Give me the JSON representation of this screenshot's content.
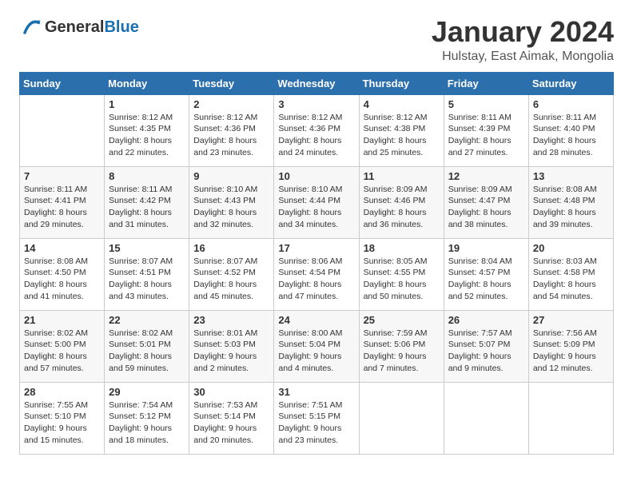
{
  "header": {
    "logo_general": "General",
    "logo_blue": "Blue",
    "month": "January 2024",
    "location": "Hulstay, East Aimak, Mongolia"
  },
  "days_of_week": [
    "Sunday",
    "Monday",
    "Tuesday",
    "Wednesday",
    "Thursday",
    "Friday",
    "Saturday"
  ],
  "weeks": [
    [
      {
        "day": "",
        "info": ""
      },
      {
        "day": "1",
        "info": "Sunrise: 8:12 AM\nSunset: 4:35 PM\nDaylight: 8 hours\nand 22 minutes."
      },
      {
        "day": "2",
        "info": "Sunrise: 8:12 AM\nSunset: 4:36 PM\nDaylight: 8 hours\nand 23 minutes."
      },
      {
        "day": "3",
        "info": "Sunrise: 8:12 AM\nSunset: 4:36 PM\nDaylight: 8 hours\nand 24 minutes."
      },
      {
        "day": "4",
        "info": "Sunrise: 8:12 AM\nSunset: 4:38 PM\nDaylight: 8 hours\nand 25 minutes."
      },
      {
        "day": "5",
        "info": "Sunrise: 8:11 AM\nSunset: 4:39 PM\nDaylight: 8 hours\nand 27 minutes."
      },
      {
        "day": "6",
        "info": "Sunrise: 8:11 AM\nSunset: 4:40 PM\nDaylight: 8 hours\nand 28 minutes."
      }
    ],
    [
      {
        "day": "7",
        "info": "Sunrise: 8:11 AM\nSunset: 4:41 PM\nDaylight: 8 hours\nand 29 minutes."
      },
      {
        "day": "8",
        "info": "Sunrise: 8:11 AM\nSunset: 4:42 PM\nDaylight: 8 hours\nand 31 minutes."
      },
      {
        "day": "9",
        "info": "Sunrise: 8:10 AM\nSunset: 4:43 PM\nDaylight: 8 hours\nand 32 minutes."
      },
      {
        "day": "10",
        "info": "Sunrise: 8:10 AM\nSunset: 4:44 PM\nDaylight: 8 hours\nand 34 minutes."
      },
      {
        "day": "11",
        "info": "Sunrise: 8:09 AM\nSunset: 4:46 PM\nDaylight: 8 hours\nand 36 minutes."
      },
      {
        "day": "12",
        "info": "Sunrise: 8:09 AM\nSunset: 4:47 PM\nDaylight: 8 hours\nand 38 minutes."
      },
      {
        "day": "13",
        "info": "Sunrise: 8:08 AM\nSunset: 4:48 PM\nDaylight: 8 hours\nand 39 minutes."
      }
    ],
    [
      {
        "day": "14",
        "info": "Sunrise: 8:08 AM\nSunset: 4:50 PM\nDaylight: 8 hours\nand 41 minutes."
      },
      {
        "day": "15",
        "info": "Sunrise: 8:07 AM\nSunset: 4:51 PM\nDaylight: 8 hours\nand 43 minutes."
      },
      {
        "day": "16",
        "info": "Sunrise: 8:07 AM\nSunset: 4:52 PM\nDaylight: 8 hours\nand 45 minutes."
      },
      {
        "day": "17",
        "info": "Sunrise: 8:06 AM\nSunset: 4:54 PM\nDaylight: 8 hours\nand 47 minutes."
      },
      {
        "day": "18",
        "info": "Sunrise: 8:05 AM\nSunset: 4:55 PM\nDaylight: 8 hours\nand 50 minutes."
      },
      {
        "day": "19",
        "info": "Sunrise: 8:04 AM\nSunset: 4:57 PM\nDaylight: 8 hours\nand 52 minutes."
      },
      {
        "day": "20",
        "info": "Sunrise: 8:03 AM\nSunset: 4:58 PM\nDaylight: 8 hours\nand 54 minutes."
      }
    ],
    [
      {
        "day": "21",
        "info": "Sunrise: 8:02 AM\nSunset: 5:00 PM\nDaylight: 8 hours\nand 57 minutes."
      },
      {
        "day": "22",
        "info": "Sunrise: 8:02 AM\nSunset: 5:01 PM\nDaylight: 8 hours\nand 59 minutes."
      },
      {
        "day": "23",
        "info": "Sunrise: 8:01 AM\nSunset: 5:03 PM\nDaylight: 9 hours\nand 2 minutes."
      },
      {
        "day": "24",
        "info": "Sunrise: 8:00 AM\nSunset: 5:04 PM\nDaylight: 9 hours\nand 4 minutes."
      },
      {
        "day": "25",
        "info": "Sunrise: 7:59 AM\nSunset: 5:06 PM\nDaylight: 9 hours\nand 7 minutes."
      },
      {
        "day": "26",
        "info": "Sunrise: 7:57 AM\nSunset: 5:07 PM\nDaylight: 9 hours\nand 9 minutes."
      },
      {
        "day": "27",
        "info": "Sunrise: 7:56 AM\nSunset: 5:09 PM\nDaylight: 9 hours\nand 12 minutes."
      }
    ],
    [
      {
        "day": "28",
        "info": "Sunrise: 7:55 AM\nSunset: 5:10 PM\nDaylight: 9 hours\nand 15 minutes."
      },
      {
        "day": "29",
        "info": "Sunrise: 7:54 AM\nSunset: 5:12 PM\nDaylight: 9 hours\nand 18 minutes."
      },
      {
        "day": "30",
        "info": "Sunrise: 7:53 AM\nSunset: 5:14 PM\nDaylight: 9 hours\nand 20 minutes."
      },
      {
        "day": "31",
        "info": "Sunrise: 7:51 AM\nSunset: 5:15 PM\nDaylight: 9 hours\nand 23 minutes."
      },
      {
        "day": "",
        "info": ""
      },
      {
        "day": "",
        "info": ""
      },
      {
        "day": "",
        "info": ""
      }
    ]
  ]
}
